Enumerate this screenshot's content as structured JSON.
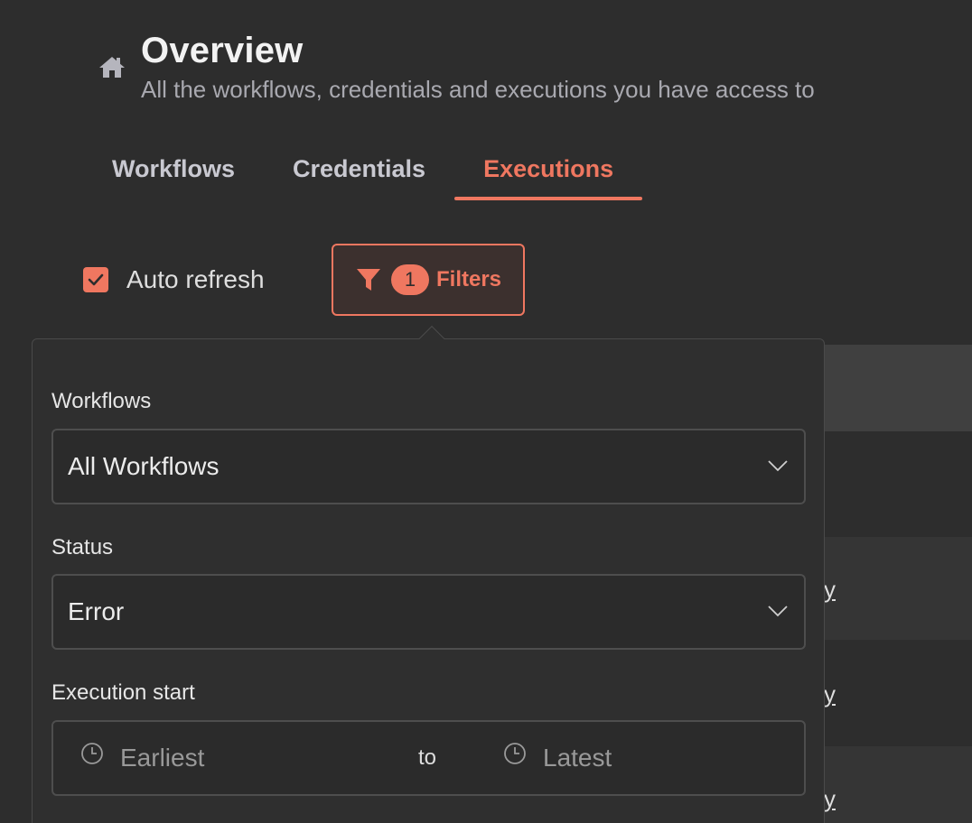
{
  "header": {
    "title": "Overview",
    "subtitle": "All the workflows, credentials and executions you have access to"
  },
  "tabs": [
    {
      "label": "Workflows",
      "active": false
    },
    {
      "label": "Credentials",
      "active": false
    },
    {
      "label": "Executions",
      "active": true
    }
  ],
  "toolbar": {
    "auto_refresh_label": "Auto refresh",
    "auto_refresh_checked": true,
    "filters_count": "1",
    "filters_label": "Filters"
  },
  "background_rows": {
    "fragments": [
      "y",
      "y",
      "y"
    ]
  },
  "filter_panel": {
    "workflows_label": "Workflows",
    "workflows_value": "All Workflows",
    "status_label": "Status",
    "status_value": "Error",
    "execution_start_label": "Execution start",
    "start_placeholder": "Earliest",
    "range_separator": "to",
    "end_placeholder": "Latest"
  },
  "colors": {
    "accent": "#ef7760",
    "background": "#2d2d2d",
    "panel": "#2f2f2f",
    "border": "#4e4e4e"
  },
  "icons": [
    "home-icon",
    "check-icon",
    "funnel-icon",
    "chevron-down-icon",
    "clock-icon"
  ]
}
